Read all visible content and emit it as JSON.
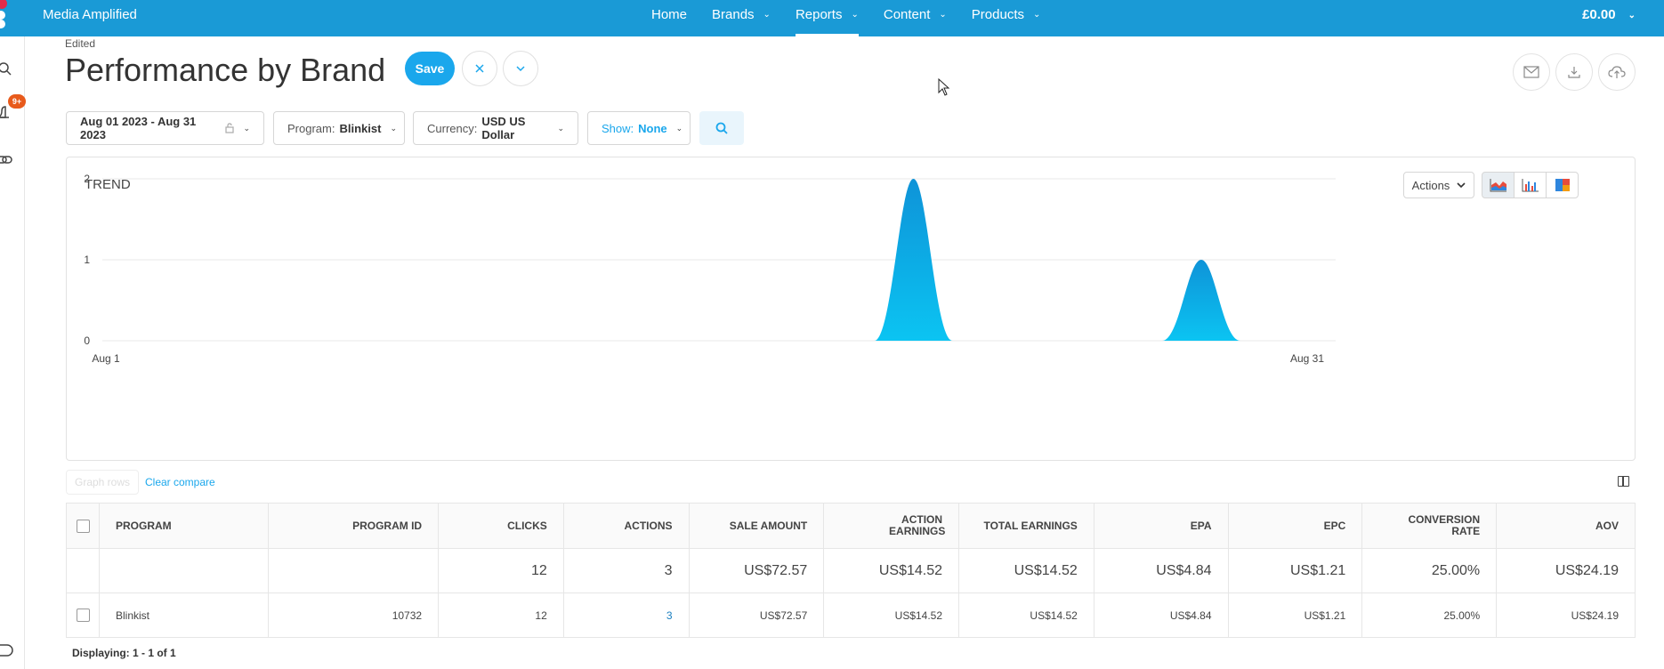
{
  "topbar": {
    "app_name": "Media Amplified",
    "nav": [
      {
        "label": "Home",
        "has_menu": false,
        "active": false
      },
      {
        "label": "Brands",
        "has_menu": true,
        "active": false
      },
      {
        "label": "Reports",
        "has_menu": true,
        "active": true
      },
      {
        "label": "Content",
        "has_menu": true,
        "active": false
      },
      {
        "label": "Products",
        "has_menu": true,
        "active": false
      }
    ],
    "balance": "£0.00"
  },
  "rail": {
    "notifications_badge": "9+"
  },
  "header": {
    "status": "Edited",
    "title": "Performance by Brand",
    "save_label": "Save"
  },
  "filters": {
    "date_range": "Aug 01 2023 - Aug 31 2023",
    "program_label": "Program:",
    "program_value": "Blinkist",
    "currency_label": "Currency:",
    "currency_value": "USD US Dollar",
    "show_label": "Show:",
    "show_value": "None"
  },
  "trend": {
    "title": "TREND",
    "actions_label": "Actions"
  },
  "chart_data": {
    "type": "area",
    "title": "TREND",
    "x_start_label": "Aug 1",
    "x_end_label": "Aug 31",
    "yticks": [
      "0",
      "1",
      "2"
    ],
    "ylim": [
      0,
      2
    ],
    "x": [
      "Aug 1",
      "Aug 2",
      "Aug 3",
      "Aug 4",
      "Aug 5",
      "Aug 6",
      "Aug 7",
      "Aug 8",
      "Aug 9",
      "Aug 10",
      "Aug 11",
      "Aug 12",
      "Aug 13",
      "Aug 14",
      "Aug 15",
      "Aug 16",
      "Aug 17",
      "Aug 18",
      "Aug 19",
      "Aug 20",
      "Aug 21",
      "Aug 22",
      "Aug 23",
      "Aug 24",
      "Aug 25",
      "Aug 26",
      "Aug 27",
      "Aug 28",
      "Aug 29",
      "Aug 30",
      "Aug 31"
    ],
    "values": [
      0,
      0,
      0,
      0,
      0,
      0,
      0,
      0,
      0,
      0,
      0,
      0,
      0,
      0,
      0,
      0,
      0,
      0,
      0,
      0,
      2,
      0,
      0,
      0,
      0,
      0,
      0,
      1,
      0,
      0,
      0
    ],
    "grid": true,
    "color": "#12a8e6"
  },
  "table": {
    "graph_rows_label": "Graph rows",
    "clear_compare": "Clear compare",
    "columns": [
      "PROGRAM",
      "PROGRAM ID",
      "CLICKS",
      "ACTIONS",
      "SALE AMOUNT",
      "ACTION EARNINGS",
      "TOTAL EARNINGS",
      "EPA",
      "EPC",
      "CONVERSION RATE",
      "AOV"
    ],
    "totals": {
      "clicks": "12",
      "actions": "3",
      "sale_amount": "US$72.57",
      "action_earnings": "US$14.52",
      "total_earnings": "US$14.52",
      "epa": "US$4.84",
      "epc": "US$1.21",
      "conversion_rate": "25.00%",
      "aov": "US$24.19"
    },
    "rows": [
      {
        "program": "Blinkist",
        "program_id": "10732",
        "clicks": "12",
        "actions": "3",
        "sale_amount": "US$72.57",
        "action_earnings": "US$14.52",
        "total_earnings": "US$14.52",
        "epa": "US$4.84",
        "epc": "US$1.21",
        "conversion_rate": "25.00%",
        "aov": "US$24.19"
      }
    ],
    "displaying": "Displaying: 1 - 1 of 1"
  }
}
